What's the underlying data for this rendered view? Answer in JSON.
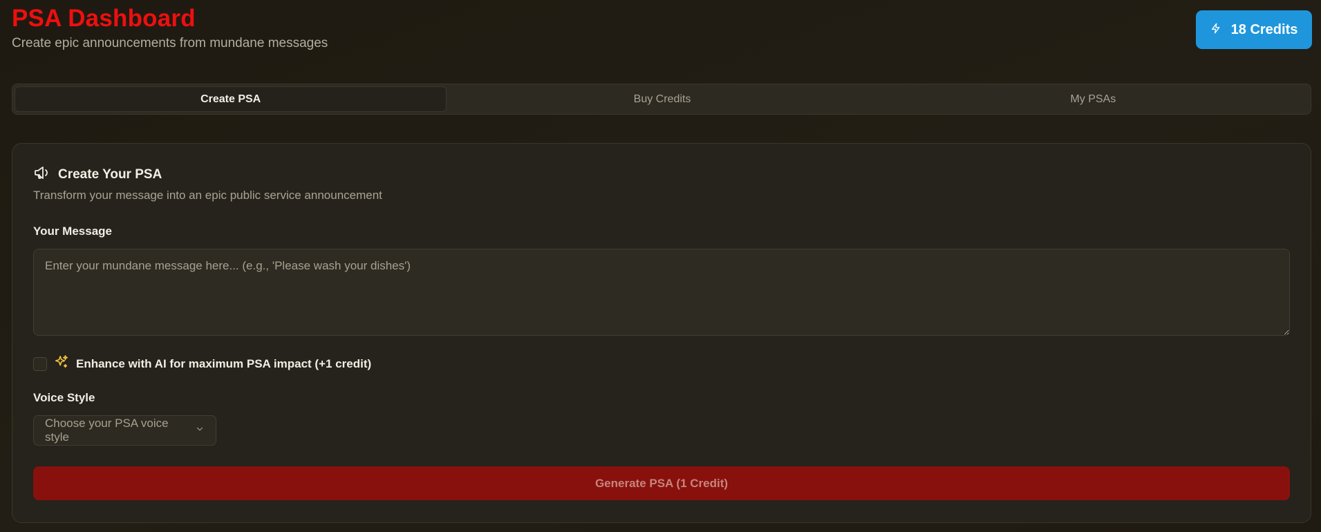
{
  "header": {
    "title": "PSA Dashboard",
    "subtitle": "Create epic announcements from mundane messages"
  },
  "credits": {
    "label": "18 Credits",
    "icon": "lightning-icon"
  },
  "tabs": [
    {
      "label": "Create PSA",
      "active": true
    },
    {
      "label": "Buy Credits",
      "active": false
    },
    {
      "label": "My PSAs",
      "active": false
    }
  ],
  "card": {
    "title": "Create Your PSA",
    "icon": "megaphone-icon",
    "description": "Transform your message into an epic public service announcement",
    "message_label": "Your Message",
    "message_placeholder": "Enter your mundane message here... (e.g., 'Please wash your dishes')",
    "message_value": "",
    "enhance_label": "Enhance with AI for maximum PSA impact (+1 credit)",
    "enhance_checked": false,
    "voice_label": "Voice Style",
    "voice_placeholder": "Choose your PSA voice style",
    "generate_label": "Generate PSA (1 Credit)"
  },
  "colors": {
    "title": "#ee0f0f",
    "credits_button": "#1f96dc",
    "generate_button": "#88110d",
    "sparkle": "#f5c542"
  }
}
